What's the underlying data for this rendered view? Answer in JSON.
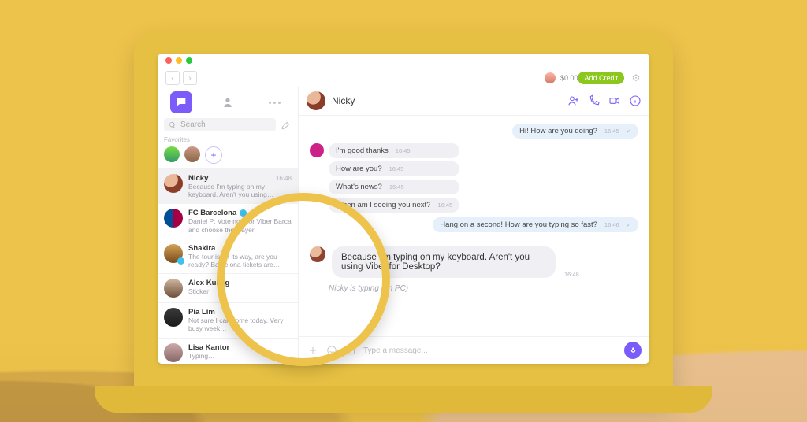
{
  "toolbar": {
    "balance": "$0.00",
    "add_credit": "Add Credit"
  },
  "sidebar": {
    "search_placeholder": "Search",
    "favorites_label": "Favorites",
    "items": [
      {
        "name": "Nicky",
        "time": "16:48",
        "preview": "Because I'm typing on my keyboard. Aren't you using…",
        "selected": true
      },
      {
        "name": "FC Barcelona",
        "time": "",
        "preview": "Daniel P: Vote now for Viber Barca and choose the player",
        "verified": true
      },
      {
        "name": "Shakira",
        "time": "",
        "preview": "The tour is on its way, are you ready? Barcelona tickets are…",
        "verified": true
      },
      {
        "name": "Alex Kulnlg",
        "time": "",
        "preview": "Sticker"
      },
      {
        "name": "Pia Lim",
        "time": "",
        "preview": "Not sure I can come today. Very busy week…"
      },
      {
        "name": "Lisa Kantor",
        "time": "",
        "preview": "Typing…"
      }
    ]
  },
  "conversation": {
    "name": "Nicky",
    "messages_out1": {
      "text": "Hi! How are you doing?",
      "time": "16:45"
    },
    "in_group": [
      {
        "text": "I'm good thanks",
        "time": "16:45"
      },
      {
        "text": "How are you?",
        "time": "16:45"
      },
      {
        "text": "What's news?",
        "time": "16:45"
      },
      {
        "text": "When am I seeing you next?",
        "time": "16:45"
      }
    ],
    "messages_out2": {
      "text": "Hang on a second! How are you typing so fast?",
      "time": "16:46"
    },
    "big_in": {
      "text": "Because I'm typing on my keyboard. Aren't you using Viber for Desktop?",
      "time": "16:48"
    },
    "typing_indicator": "Nicky is typing (on PC)",
    "composer_placeholder": "Type a message..."
  }
}
